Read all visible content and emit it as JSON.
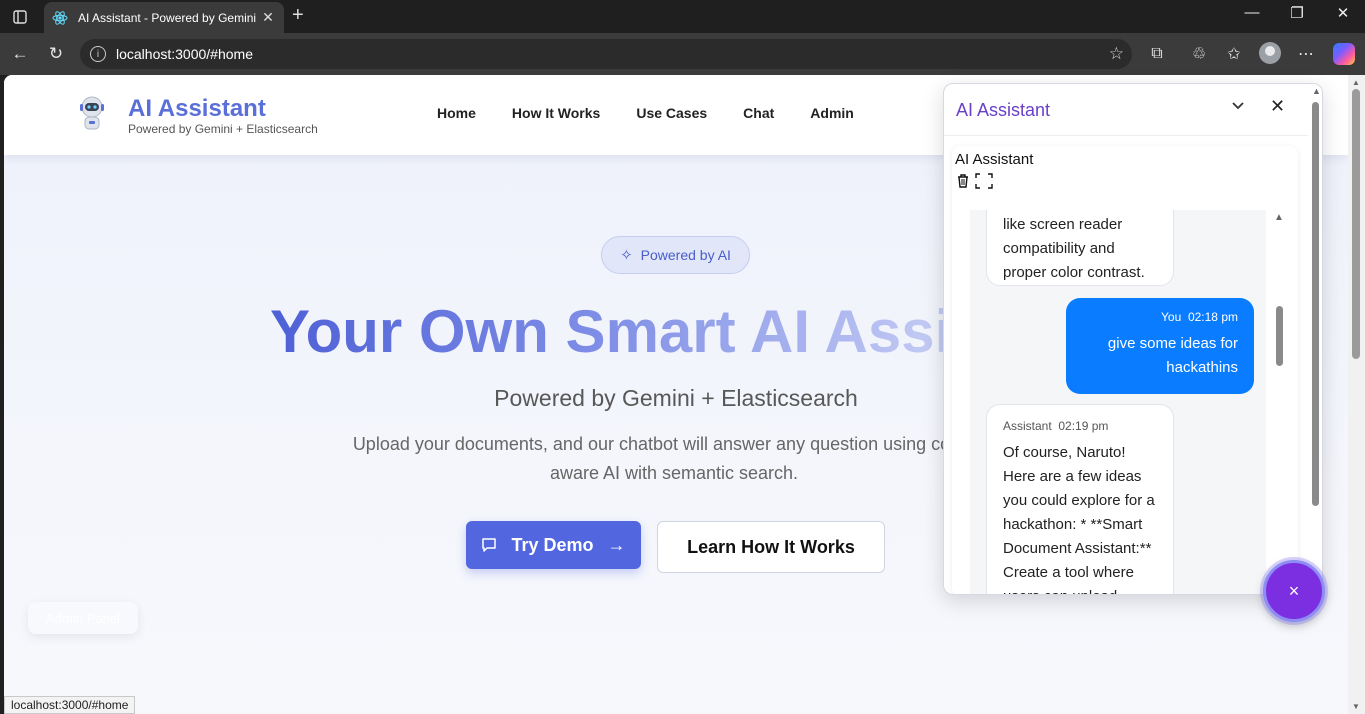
{
  "browser": {
    "tab_title": "AI Assistant - Powered by Gemini + Elasticsearch",
    "url": "localhost:3000/#home",
    "status_url": "localhost:3000/#home"
  },
  "site": {
    "brand_title": "AI Assistant",
    "brand_subtitle": "Powered by Gemini + Elasticsearch",
    "nav": [
      "Home",
      "How It Works",
      "Use Cases",
      "Chat",
      "Admin"
    ]
  },
  "hero": {
    "badge": "Powered by AI",
    "title": "Your Own Smart AI Assistant",
    "subtitle": "Powered by Gemini + Elasticsearch",
    "description": "Upload your documents, and our chatbot will answer any question using context-aware AI with semantic search.",
    "primary_button": "Try Demo",
    "secondary_button": "Learn How It Works",
    "admin_panel": "Admin Panel"
  },
  "chat": {
    "header_title": "AI Assistant",
    "inner_title": "AI Assistant",
    "messages": [
      {
        "role": "assistant",
        "text": "like screen reader compatibility and proper color contrast."
      },
      {
        "role": "user",
        "sender": "You",
        "time": "02:18 pm",
        "text": "give some ideas for hackathins"
      },
      {
        "role": "assistant",
        "sender": "Assistant",
        "time": "02:19 pm",
        "text": "Of course, Naruto! Here are a few ideas you could explore for a hackathon: * **Smart Document Assistant:** Create a tool where users can upload..."
      }
    ],
    "fab_icon": "×"
  },
  "colors": {
    "brand": "#5a6fd8",
    "primary_button": "#5266e0",
    "chat_title": "#6a40c8",
    "user_bubble": "#0a7cff",
    "fab": "#7b2fe0"
  }
}
